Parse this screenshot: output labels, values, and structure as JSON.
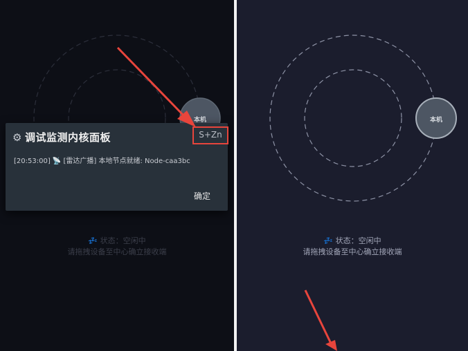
{
  "colors": {
    "left_bg": "#0d0f16",
    "right_bg": "#1b1d2d",
    "dialog_bg": "#28313a",
    "annotation_red": "#e8453c",
    "device_circle": "#4d5663"
  },
  "left_screen": {
    "device_label": "本机",
    "status": "💤 状态：空闲中",
    "hint": "请拖拽设备至中心确立接收端"
  },
  "right_screen": {
    "device_label": "本机",
    "status": "💤 状态：空闲中",
    "hint": "请拖拽设备至中心确立接收端"
  },
  "dialog": {
    "icon": "gear-icon",
    "icon_glyph": "⚙",
    "title": "调试监测内核面板",
    "shortcut": "S+Zn",
    "log_line": "[20:53:00] 📡 [雷达广播] 本地节点就绪: Node-caa3bc",
    "ok_label": "确定"
  }
}
